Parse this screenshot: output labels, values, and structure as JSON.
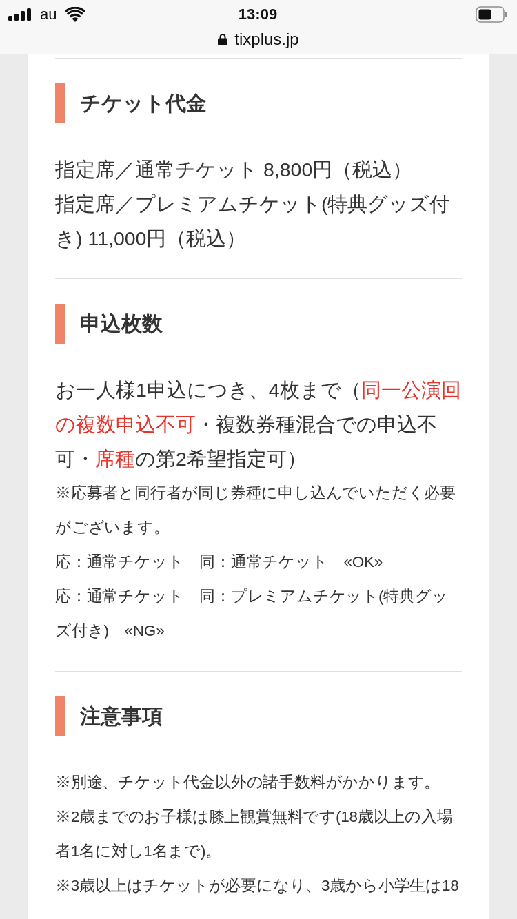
{
  "status_bar": {
    "carrier": "au",
    "time": "13:09"
  },
  "address_bar": {
    "url": "tixplus.jp"
  },
  "sections": [
    {
      "title": "チケット代金",
      "body": [
        {
          "kind": "lead",
          "text": "指定席／通常チケット 8,800円（税込）"
        },
        {
          "kind": "lead",
          "text": "指定席／プレミアムチケット(特典グッズ付き) 11,000円（税込）"
        }
      ]
    },
    {
      "title": "申込枚数",
      "body": [
        {
          "kind": "lead",
          "segments": [
            {
              "text": "お一人様1申込につき、4枚まで（",
              "highlight": false
            },
            {
              "text": "同一公演回の複数申込不可",
              "highlight": true
            },
            {
              "text": "・複数券種混合での申込不可・",
              "highlight": false
            },
            {
              "text": "席種",
              "highlight": true
            },
            {
              "text": "の第2希望指定可）",
              "highlight": false
            }
          ]
        },
        {
          "kind": "note",
          "text": "※応募者と同行者が同じ券種に申し込んでいただく必要がございます。"
        },
        {
          "kind": "note",
          "text": "応：通常チケット　同：通常チケット　«OK»"
        },
        {
          "kind": "note",
          "text": "応：通常チケット　同：プレミアムチケット(特典グッズ付き)　«NG»"
        }
      ]
    },
    {
      "title": "注意事項",
      "body": [
        {
          "kind": "note",
          "text": "※別途、チケット代金以外の諸手数料がかかります。"
        },
        {
          "kind": "note",
          "text": "※2歳までのお子様は膝上観賞無料です(18歳以上の入場者1名に対し1名まで)。"
        },
        {
          "kind": "note",
          "text": "※3歳以上はチケットが必要になり、3歳から小学生は18"
        }
      ]
    }
  ]
}
